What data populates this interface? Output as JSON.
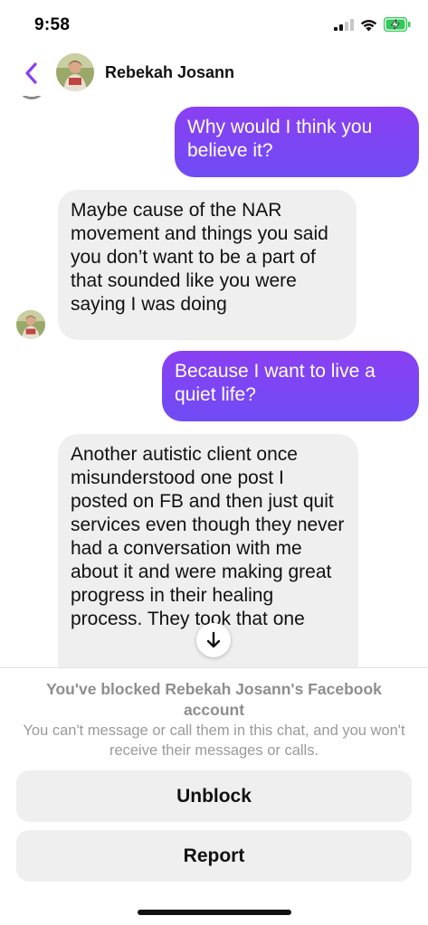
{
  "status": {
    "time": "9:58"
  },
  "header": {
    "contact_name": "Rebekah Josann"
  },
  "messages": [
    {
      "direction": "outgoing",
      "text": "Why would I think you believe it?"
    },
    {
      "direction": "incoming",
      "text": "Maybe cause of the NAR movement and things you said you don’t want to be a part of that sounded like you were saying I was doing"
    },
    {
      "direction": "outgoing",
      "text": "Because I want to live a quiet life?"
    },
    {
      "direction": "incoming",
      "text": "Another autistic client once misunderstood one post I posted on FB and then just quit services even though they never had a conversation with me about it and were making great progress in their healing process. They took that one"
    }
  ],
  "blocked": {
    "title": "You've blocked Rebekah Josann's Facebook account",
    "description": "You can't message or call them in this chat, and you won't receive their messages or calls.",
    "unblock_label": "Unblock",
    "report_label": "Report"
  },
  "colors": {
    "accent": "#8a3ff2",
    "outgoing_bubble": "#7a45f4",
    "incoming_bubble": "#efefef",
    "battery": "#34c759"
  },
  "icons": [
    "chevron-left-icon",
    "signal-icon",
    "wifi-icon",
    "battery-charging-icon",
    "arrow-down-icon"
  ]
}
